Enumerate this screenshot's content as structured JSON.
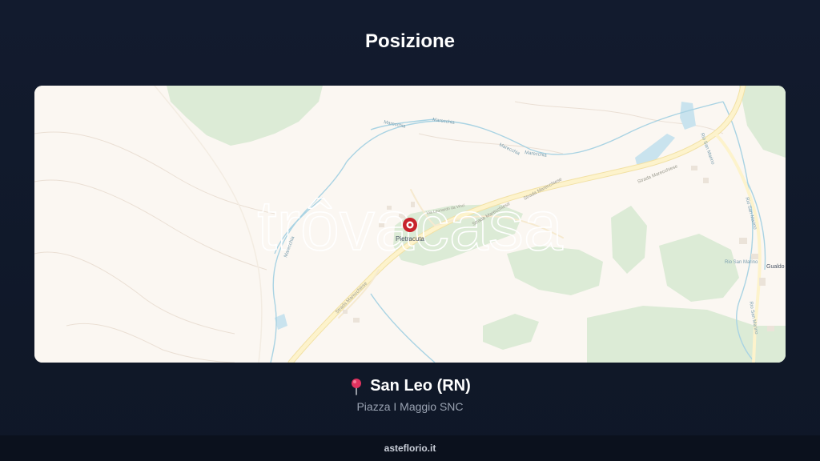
{
  "header": {
    "title": "Posizione"
  },
  "map": {
    "watermark": "trôvacasa",
    "marker_label": "Pietracuta",
    "labels": {
      "strada_1": "Strada Marecchiese",
      "strada_2": "Strada Marecchiese",
      "strada_3": "Strada Marecchiese",
      "strada_4": "Strada Marecchiese",
      "river_1": "Marecchia",
      "river_2": "Marecchia",
      "river_3": "Marecchia",
      "river_4": "Marecchia",
      "river_5": "Marecchia",
      "rio_1": "Rio San Marino",
      "rio_2": "Rio San Marino",
      "rio_3": "Rio San Marino",
      "rio_4": "Rio San Marino",
      "place_right": "Gualdo",
      "minor_road": "Via Leonardo da Vinci"
    },
    "colors": {
      "land": "#fbf7f2",
      "forest": "#d9ead3",
      "road": "#fdf1c9",
      "water": "#bfe0ec",
      "marker": "#c8232c"
    }
  },
  "location": {
    "pin_icon": "round-pushpin-icon",
    "city": "San Leo (RN)",
    "address": "Piazza I Maggio SNC"
  },
  "footer": {
    "site": "asteflorio.it"
  }
}
